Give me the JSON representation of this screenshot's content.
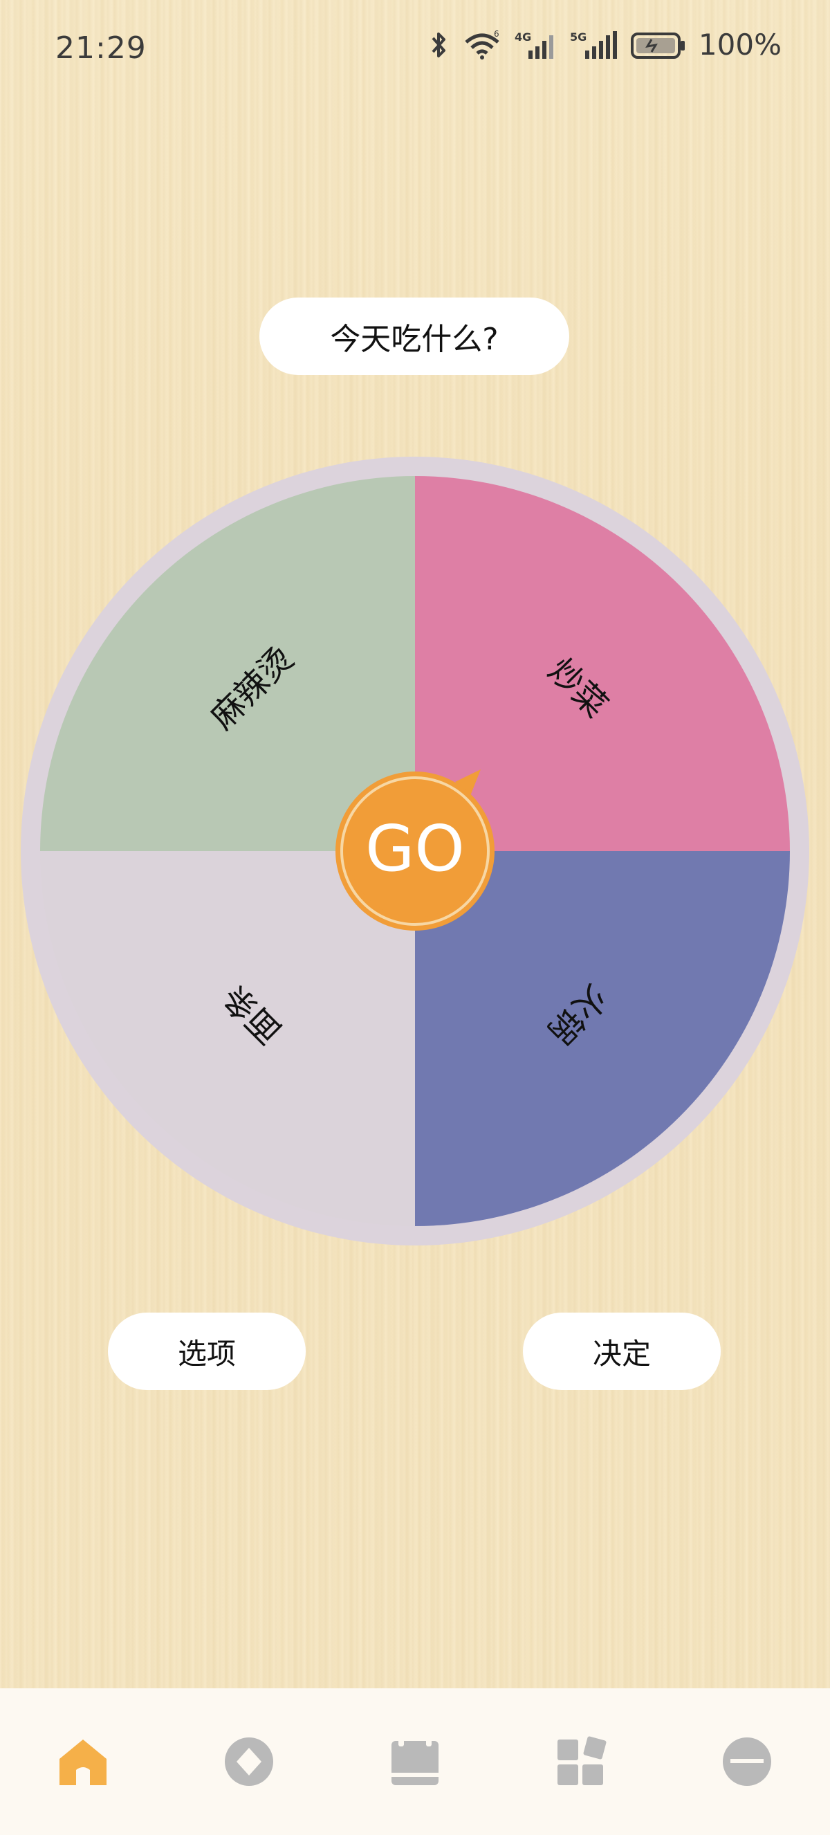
{
  "status": {
    "time": "21:29",
    "battery": "100%",
    "network_4g": "4G",
    "network_5g": "5G",
    "wifi_badge": "6"
  },
  "title": "今天吃什么?",
  "wheel": {
    "go_label": "GO",
    "segments": [
      {
        "label": "炒菜",
        "color": "#de7fa5"
      },
      {
        "label": "火锅",
        "color": "#7179b0"
      },
      {
        "label": "面条",
        "color": "#dbd3da"
      },
      {
        "label": "麻辣烫",
        "color": "#b8c8b4"
      }
    ],
    "rim_color": "#dcd3dc",
    "go_color": "#f19d38"
  },
  "buttons": {
    "options": "选项",
    "decide": "决定"
  },
  "nav": {
    "active_color": "#f5b049",
    "inactive_color": "#b9b9b9",
    "items": [
      "home-icon",
      "discover-icon",
      "calendar-icon",
      "apps-icon",
      "profile-icon"
    ]
  }
}
